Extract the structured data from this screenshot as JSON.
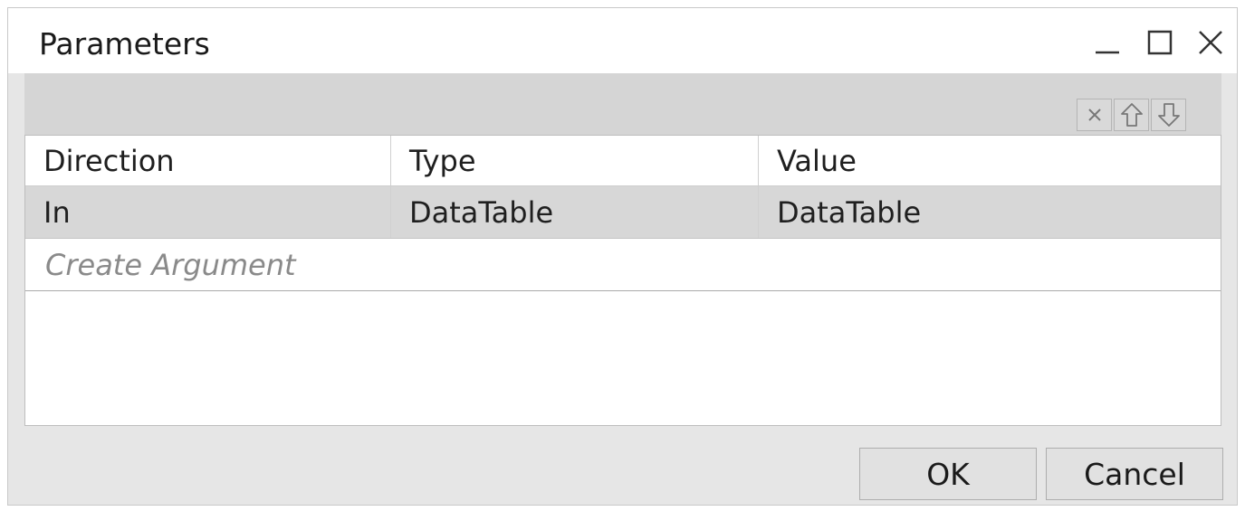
{
  "window": {
    "title": "Parameters",
    "controls": {
      "minimize": "minimize",
      "maximize": "maximize",
      "close": "close"
    }
  },
  "toolbar": {
    "icons": [
      "delete-icon",
      "move-up-icon",
      "move-down-icon"
    ]
  },
  "table": {
    "columns": [
      "Direction",
      "Type",
      "Value"
    ],
    "rows": [
      [
        "In",
        "DataTable",
        "DataTable"
      ]
    ],
    "create_placeholder": "Create Argument"
  },
  "footer": {
    "ok_label": "OK",
    "cancel_label": "Cancel"
  },
  "colors": {
    "dialog_background": "#e6e6e6",
    "toolbar_background": "#d5d5d5",
    "selected_row": "#d7d7d7",
    "placeholder_text": "#8a8a8a"
  }
}
